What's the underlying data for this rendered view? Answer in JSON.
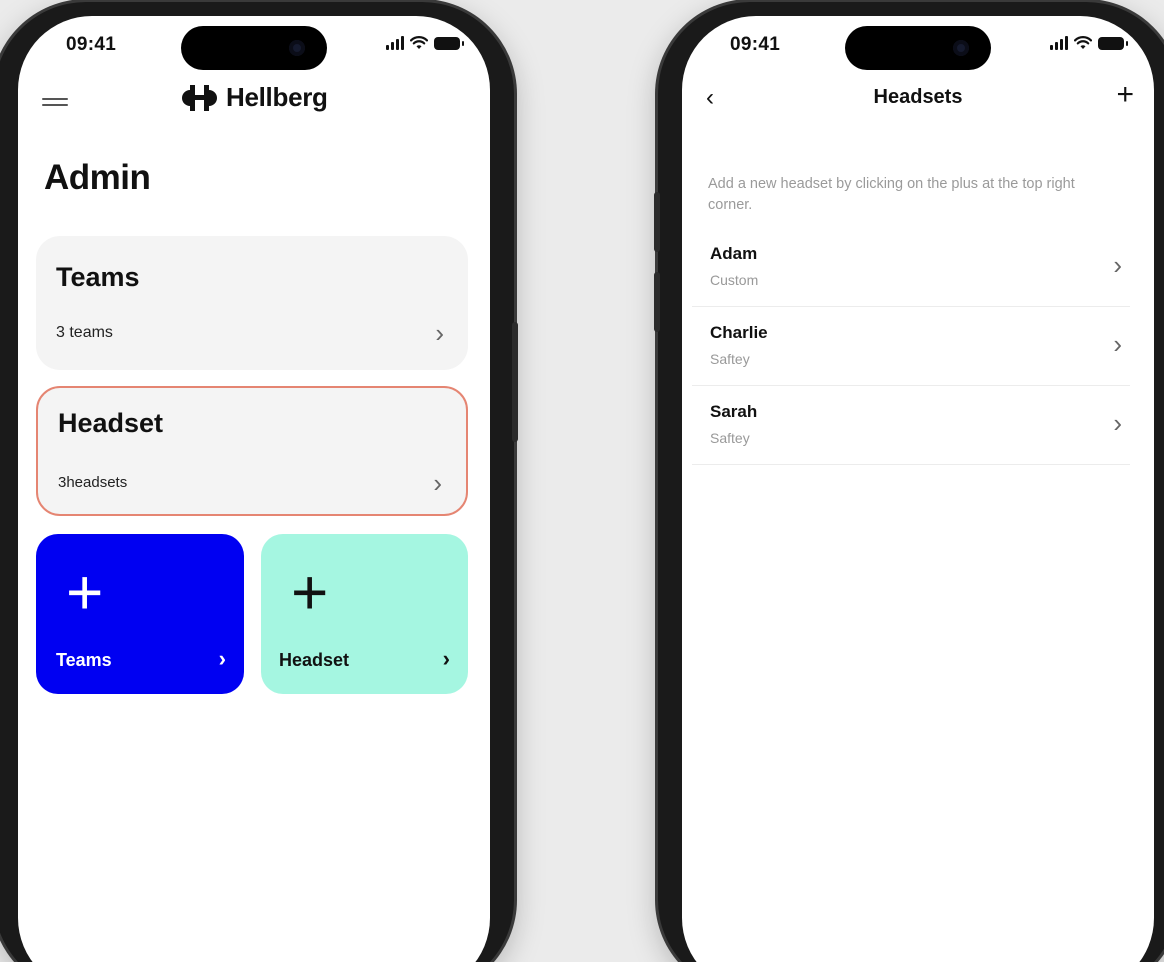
{
  "left_screen": {
    "status": {
      "time": "09:41"
    },
    "logo_text": "Hellberg",
    "title": "Admin",
    "cards": [
      {
        "title": "Teams",
        "subtitle": "3 teams"
      },
      {
        "title": "Headset",
        "subtitle": "3headsets"
      }
    ],
    "tiles": [
      {
        "label": "Teams",
        "plus": "+",
        "chevron": "›",
        "color": "#0000f2"
      },
      {
        "label": "Headset",
        "plus": "+",
        "chevron": "›",
        "color": "#a5f6e1"
      }
    ],
    "accent_border": "#e58572"
  },
  "right_screen": {
    "status": {
      "time": "09:41"
    },
    "nav": {
      "back": "‹",
      "title": "Headsets",
      "add": "+"
    },
    "hint": "Add a new headset by clicking on the plus at the top right corner.",
    "headsets": [
      {
        "name": "Adam",
        "type": "Custom"
      },
      {
        "name": "Charlie",
        "type": "Saftey"
      },
      {
        "name": "Sarah",
        "type": "Saftey"
      }
    ]
  },
  "icons": [
    "menu-icon",
    "hellberg-logo-icon",
    "chevron-right-icon",
    "plus-icon",
    "back-icon",
    "signal-icon",
    "wifi-icon",
    "battery-icon"
  ]
}
